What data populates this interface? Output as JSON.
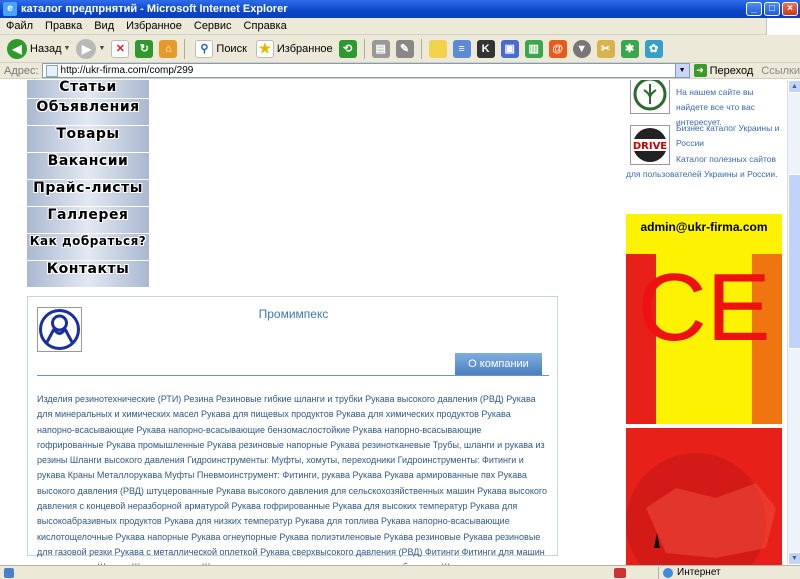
{
  "window": {
    "title": "каталог предпрнятий - Microsoft Internet Explorer",
    "buttons": {
      "minimize": "_",
      "maximize": "□",
      "close": "×"
    }
  },
  "menu": {
    "items": [
      "Файл",
      "Правка",
      "Вид",
      "Избранное",
      "Сервис",
      "Справка"
    ]
  },
  "toolbar": {
    "back_label": "Назад",
    "search_label": "Поиск",
    "favorites_label": "Избранное"
  },
  "address": {
    "label": "Адрес:",
    "url": "http://ukr-firma.com/comp/299",
    "go_label": "Переход",
    "links_label": "Ссылки"
  },
  "nav": {
    "items": [
      "Статьи",
      "Объявления",
      "Товары",
      "Вакансии",
      "Прайс-листы",
      "Галлерея",
      "Как добраться?",
      "Контакты"
    ]
  },
  "company": {
    "name": "Промимпекс",
    "about_tab": "О компании",
    "description": "Изделия резинотехнические (РТИ) Резина Резиновые гибкие шланги и трубки Рукава высокого давления (РВД) Рукава для минеральных и химических масел Рукава для пищевых продуктов Рукава для химических продуктов Рукава напорно-всасывающие Рукава напорно-всасывающие бензомаслостойкие Рукава напорно-всасывающие гофрированные Рукава промышленные Рукава резиновые напорные Рукава резинотканевые Трубы, шланги и рукава из резины Шланги высокого давления Гидроинструменты: Муфты, хомуты, переходники Гидроинструменты: Фитинги и рукава Краны Металлорукава Муфты Пневмоинструмент: Фитинги, рукава Рукава Рукава армированные пвх Рукава высокого давления (РВД) штуцерованные Рукава высокого давления для сельскохозяйственных машин Рукава высокого давления с концевой неразборной арматурой Рукава гофрированные Рукава для высоких температур Рукава для высокоабразивных продуктов Рукава для низких температур Рукава для топлива Рукава напорно-всасывающие кислотощелочные Рукава напорные Рукава огнеупорные Рукава полиэтиленовые Рукава резиновые Рукава резиновые для газовой резки Рукава с металлической оплеткой Рукава сверхвысокого давления (РВД) Фитинги Фитинги для машин и механизмов Шланги Шланги газовые Шланги тормозные, топливные и другие автомобильные Штуцеры"
  },
  "sidebar": {
    "promo1": "На нашем сайте вы найдете все что вас интересует.",
    "drive_logo_text": "DRIVE",
    "promo2_link": "Бизнес каталог Украины и России",
    "promo3": "Каталог полезных сайтов для пользователей Украины и России.",
    "banner_email": "admin@ukr-firma.com",
    "banner_ce": "CE"
  },
  "status": {
    "zone": "Интернет"
  },
  "colors": {
    "title_bar": "#0a47c9",
    "link_blue": "#3b6ab0",
    "banner_yellow": "#fdf200",
    "banner_red": "#e8201a"
  }
}
